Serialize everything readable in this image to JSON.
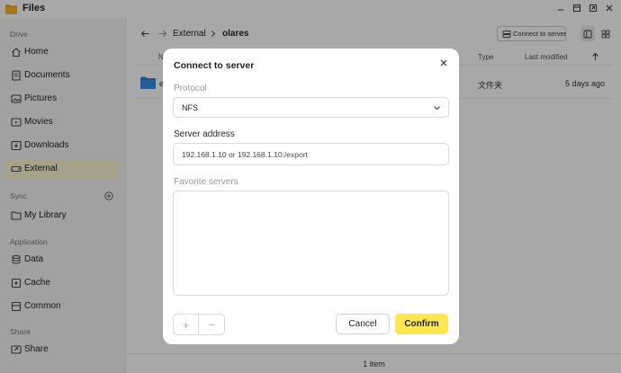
{
  "window": {
    "title": "Files",
    "minimize_icon": "minimize-icon",
    "maximize_icon": "maximize-icon",
    "close_icon": "close-icon"
  },
  "sidebar": {
    "sections": [
      {
        "label": "Drive",
        "items": [
          {
            "label": "Home",
            "icon": "home-icon"
          },
          {
            "label": "Documents",
            "icon": "document-icon"
          },
          {
            "label": "Pictures",
            "icon": "pictures-icon"
          },
          {
            "label": "Movies",
            "icon": "movies-icon"
          },
          {
            "label": "Downloads",
            "icon": "download-icon"
          },
          {
            "label": "External",
            "icon": "external-drive-icon",
            "active": true
          }
        ]
      },
      {
        "label": "Sync",
        "items": [
          {
            "label": "My Library",
            "icon": "folder-icon"
          }
        ]
      },
      {
        "label": "Application",
        "items": [
          {
            "label": "Data",
            "icon": "data-icon"
          },
          {
            "label": "Cache",
            "icon": "cache-icon"
          },
          {
            "label": "Common",
            "icon": "common-icon"
          }
        ]
      },
      {
        "label": "Share",
        "items": [
          {
            "label": "Share",
            "icon": "share-icon"
          }
        ]
      }
    ]
  },
  "main": {
    "breadcrumb": [
      "External",
      "olares"
    ],
    "connect_button": "Connect to server",
    "columns": [
      "N",
      "Type",
      "Last modified"
    ],
    "rows": [
      {
        "name": "e",
        "type": "文件夹",
        "modified": "5 days ago"
      }
    ],
    "status": "1 item"
  },
  "dialog": {
    "title": "Connect to server",
    "protocol_label": "Protocol",
    "protocol_value": "NFS",
    "address_label": "Server address",
    "address_placeholder": "192.168.1.10 or 192.168.1.10:/export",
    "favorites_label": "Favorite servers",
    "add_symbol": "+",
    "remove_symbol": "−",
    "cancel_label": "Cancel",
    "confirm_label": "Confirm"
  },
  "colors": {
    "accent": "#ffe84d",
    "active_bg": "#fbf5d2",
    "folder": "#2d7fd7"
  }
}
